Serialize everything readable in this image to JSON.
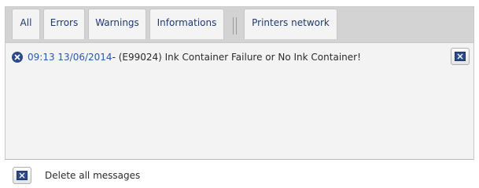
{
  "tabs": [
    {
      "label": "All",
      "active": true
    },
    {
      "label": "Errors",
      "active": false
    },
    {
      "label": "Warnings",
      "active": false
    },
    {
      "label": "Informations",
      "active": false
    }
  ],
  "extra_tab": {
    "label": "Printers network"
  },
  "messages": [
    {
      "severity_icon": "error-icon",
      "timestamp": "09:13 13/06/2014",
      "text": " - (E99024) Ink Container Failure or No Ink Container!",
      "action_icon": "delete-message-icon"
    }
  ],
  "footer": {
    "delete_all_label": "Delete all messages",
    "delete_all_icon": "delete-message-icon"
  },
  "colors": {
    "tab_text": "#1e3a6e",
    "timestamp": "#2a5aa8",
    "error_icon": "#2a4a8a"
  }
}
